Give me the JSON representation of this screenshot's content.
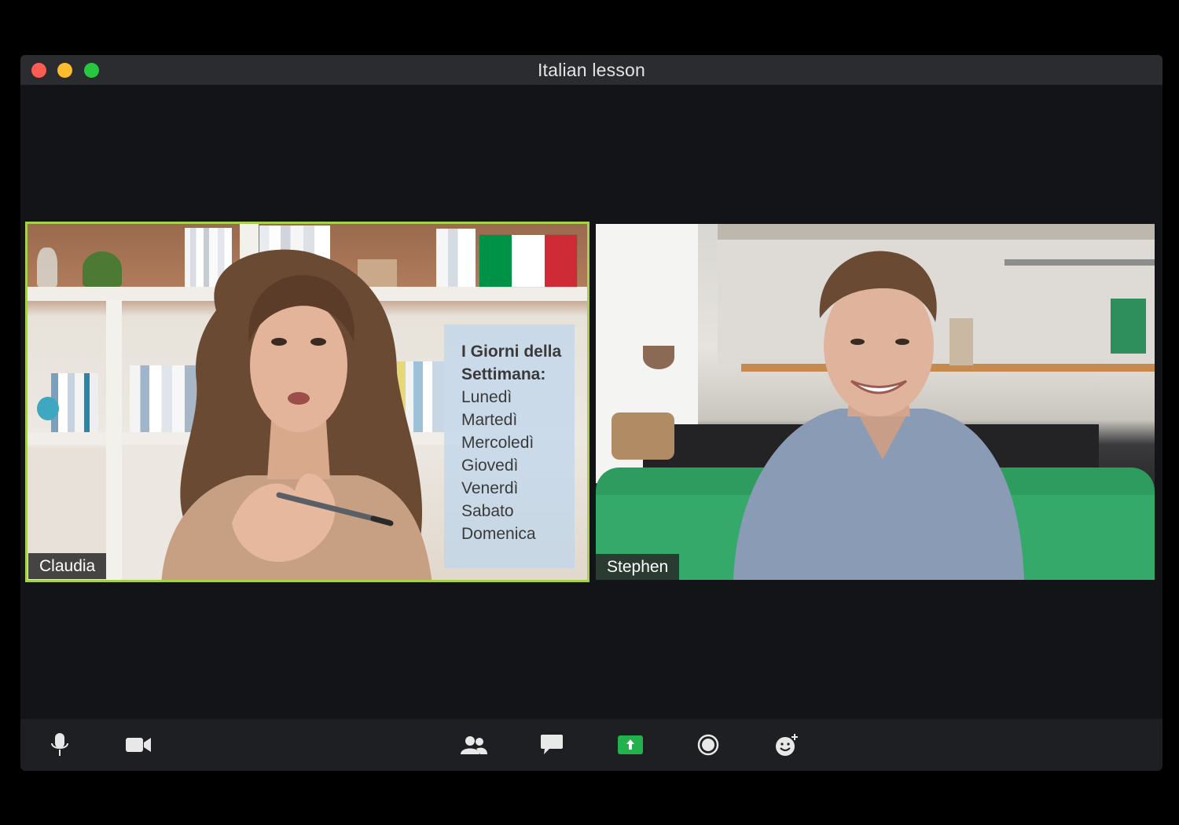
{
  "window": {
    "title": "Italian lesson"
  },
  "participants": [
    {
      "name": "Claudia",
      "active_speaker": true,
      "slide": {
        "title": "I Giorni della Settimana:",
        "days": [
          "Lunedì",
          "Martedì",
          "Mercoledì",
          "Giovedì",
          "Venerdì",
          "Sabato",
          "Domenica"
        ]
      }
    },
    {
      "name": "Stephen",
      "active_speaker": false
    }
  ],
  "toolbar": {
    "left_buttons": [
      "microphone-icon",
      "video-camera-icon"
    ],
    "center_buttons": [
      "participants-icon",
      "chat-icon",
      "share-screen-icon",
      "record-icon",
      "reactions-icon"
    ]
  },
  "colors": {
    "active_speaker_border": "#a9d04c",
    "share_button": "#22b14c",
    "flag_green": "#009246",
    "flag_white": "#ffffff",
    "flag_red": "#ce2b37"
  }
}
